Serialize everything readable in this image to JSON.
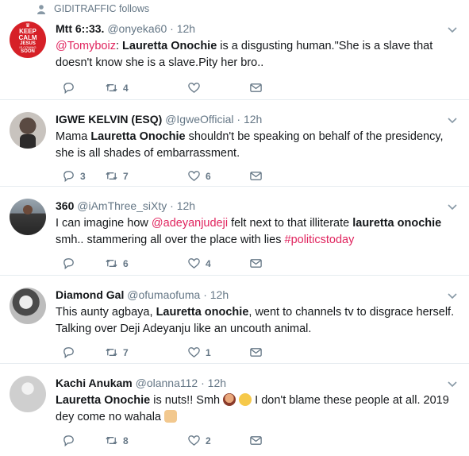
{
  "context": {
    "label": "GIDITRAFFIC follows",
    "icon": "person-icon"
  },
  "avatar1": {
    "line1": "KEEP",
    "line2": "CALM",
    "line3": "JESUS",
    "line4": "IS COMING",
    "line5": "SOON"
  },
  "tweets": [
    {
      "name": "Mtt 6::33.",
      "handle": "@onyeka60",
      "time": "12h",
      "mention": "@Tomyboiz",
      "sep": ": ",
      "bold": "Lauretta Onochie",
      "rest": " is a disgusting human.\"She is a slave that doesn't know she is a slave.Pity her bro..",
      "replies": "",
      "retweets": "4",
      "likes": ""
    },
    {
      "name": "IGWE KELVIN (ESQ)",
      "handle": "@IgweOfficial",
      "time": "12h",
      "pre": "Mama ",
      "bold": "Lauretta Onochie",
      "rest": " shouldn't be speaking on behalf of the presidency, she is all shades of embarrassment.",
      "replies": "3",
      "retweets": "7",
      "likes": "6"
    },
    {
      "name": "360",
      "handle": "@iAmThree_siXty",
      "time": "12h",
      "pre": "I can imagine how ",
      "mention": "@adeyanjudeji",
      "mid": " felt next to that illiterate ",
      "bold": "lauretta onochie",
      "rest": " smh.. stammering all over the place with lies ",
      "hashtag": "#politicstoday",
      "replies": "",
      "retweets": "6",
      "likes": "4"
    },
    {
      "name": "Diamond Gal",
      "handle": "@ofumaofuma",
      "time": "12h",
      "pre": "This aunty agbaya, ",
      "bold": "Lauretta onochie",
      "rest": ", went to channels tv to disgrace herself. Talking over Deji Adeyanju like an uncouth animal.",
      "replies": "",
      "retweets": "7",
      "likes": "1"
    },
    {
      "name": "Kachi Anukam",
      "handle": "@olanna112",
      "time": "12h",
      "bold": "Lauretta Onochie",
      "rest": " is nuts!! Smh ",
      "rest2": " I don't blame these people at all. 2019 dey come no wahala ",
      "replies": "",
      "retweets": "8",
      "likes": "2"
    }
  ],
  "dot": "·",
  "colors": {
    "accent": "#e0245e",
    "muted": "#657786",
    "border": "#e6ecf0"
  }
}
